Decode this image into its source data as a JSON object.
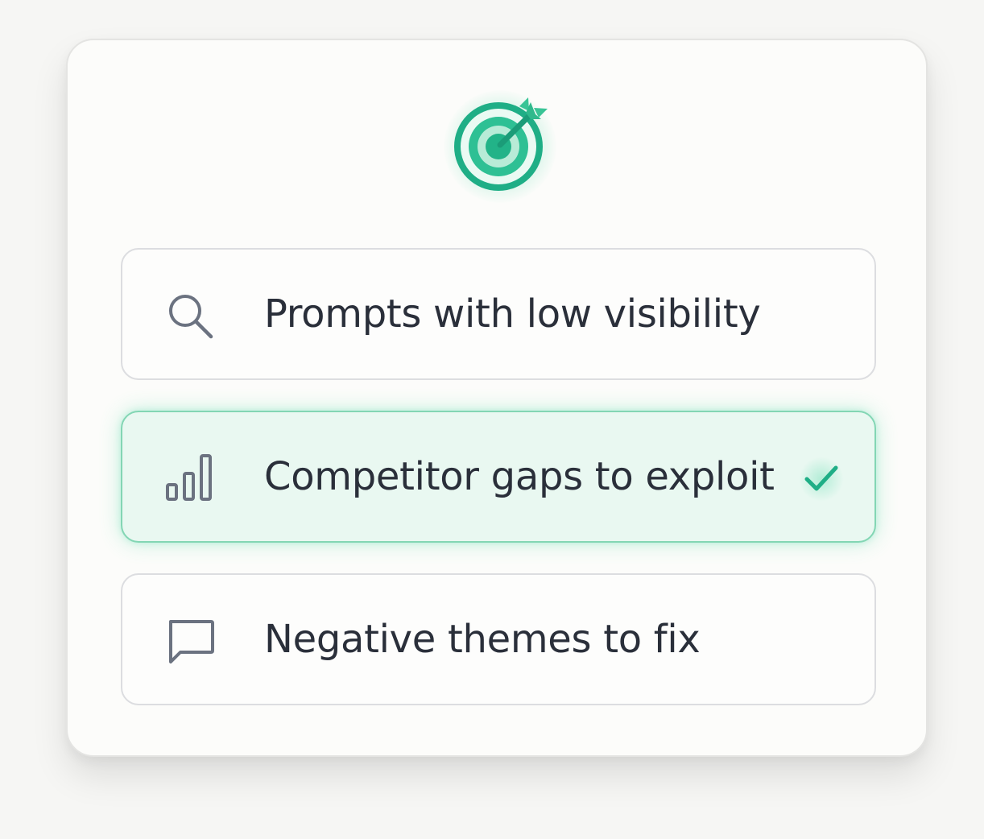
{
  "header": {
    "icon": "target-arrow-icon",
    "accent_color": "#1fae86"
  },
  "options": [
    {
      "label": "Prompts with low visibility",
      "icon": "search-icon",
      "selected": false
    },
    {
      "label": "Competitor gaps to exploit",
      "icon": "bar-chart-icon",
      "selected": true
    },
    {
      "label": "Negative themes to fix",
      "icon": "message-icon",
      "selected": false
    }
  ],
  "colors": {
    "accent": "#1fae86",
    "selected_background": "#e9f8f1",
    "selected_border": "#83d6b4",
    "text": "#2a2f3a",
    "icon_gray": "#6b7280"
  }
}
